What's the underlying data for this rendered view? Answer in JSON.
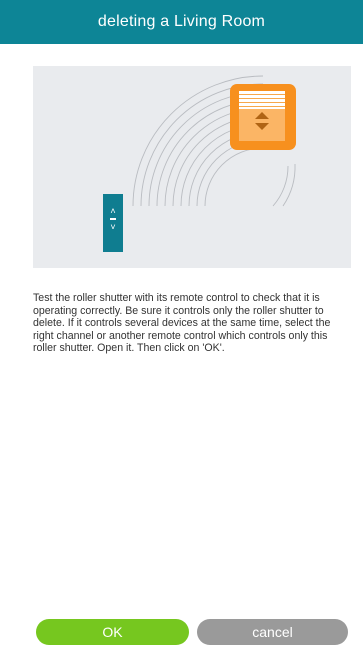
{
  "header": {
    "title": "deleting a Living Room"
  },
  "illustration": {
    "remote_control_icon": "remote-control-icon",
    "roller_shutter_icon": "roller-shutter-icon",
    "signal_waves_icon": "signal-waves-icon",
    "remote_up_glyph": "˄",
    "remote_down_glyph": "˅"
  },
  "instructions": {
    "text": "Test the roller shutter with its remote control to check that it is operating correctly. Be sure it controls only the roller shutter to delete. If it controls several devices at the same time, select the right channel or another remote control which controls only this roller shutter. Open it. Then click on 'OK'."
  },
  "buttons": {
    "ok_label": "OK",
    "cancel_label": "cancel"
  },
  "colors": {
    "header_bg": "#0d8596",
    "ok_bg": "#76c71f",
    "cancel_bg": "#9a9a9a",
    "shutter_orange": "#f7901e",
    "remote_teal": "#0f7d90"
  }
}
